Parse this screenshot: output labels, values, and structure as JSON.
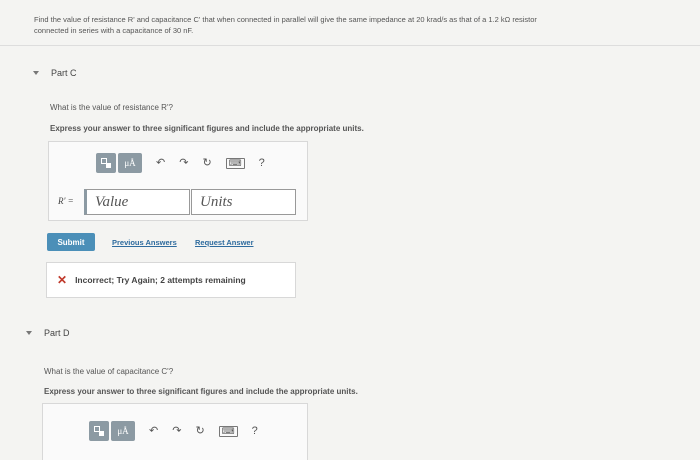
{
  "problem": {
    "line1": "Find the value of resistance R' and capacitance C' that when connected in parallel will give the same impedance at 20 krad/s as that of a 1.2 kΩ resistor",
    "line2": "connected in series with a capacitance of 30 nF."
  },
  "partC": {
    "title": "Part C",
    "question": "What is the value of resistance R'?",
    "instruction": "Express your answer to three significant figures and include the appropriate units.",
    "answer_label": "R' =",
    "value_placeholder": "Value",
    "units_placeholder": "Units",
    "submit_label": "Submit",
    "previous_answers_label": "Previous Answers",
    "request_answer_label": "Request Answer",
    "feedback": "Incorrect; Try Again; 2 attempts remaining"
  },
  "partD": {
    "title": "Part D",
    "question": "What is the value of capacitance C'?",
    "instruction": "Express your answer to three significant figures and include the appropriate units."
  },
  "toolbar": {
    "units_button_label": "μÅ",
    "help_label": "?"
  },
  "colors": {
    "accent": "#4b8fb8",
    "toolbar_button": "#8c9aa3",
    "error": "#c0392b",
    "link": "#2e6b9e"
  }
}
